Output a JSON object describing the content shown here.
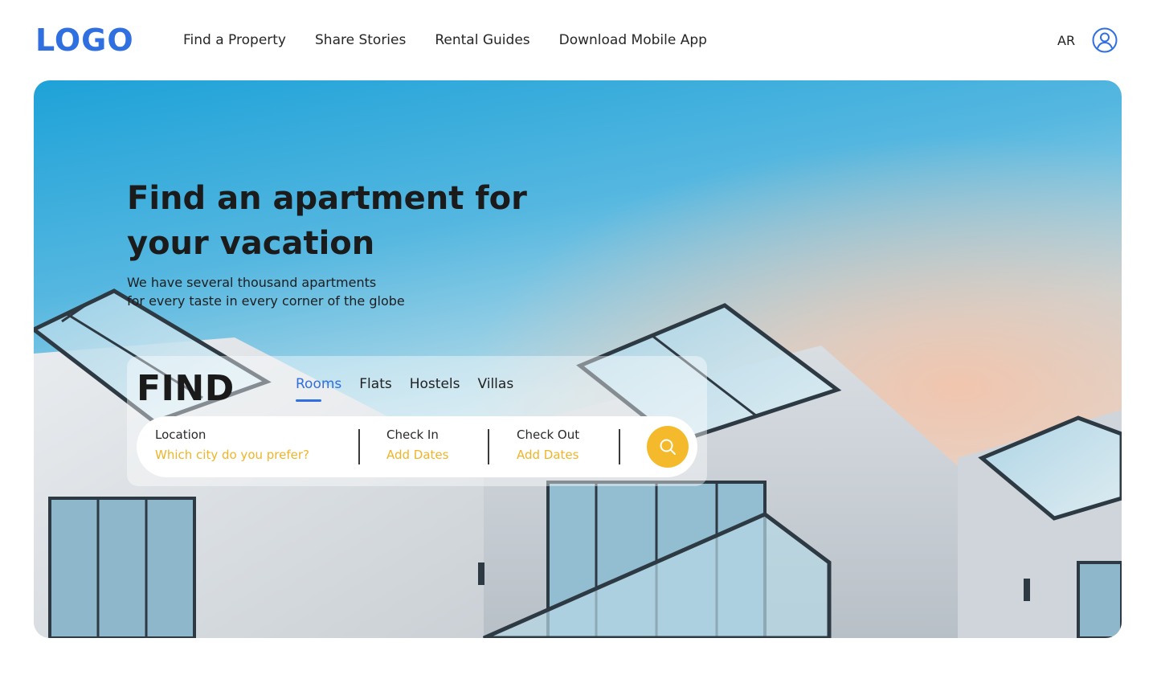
{
  "header": {
    "logo": "LOGO",
    "nav": [
      {
        "label": "Find a Property"
      },
      {
        "label": "Share Stories"
      },
      {
        "label": "Rental Guides"
      },
      {
        "label": "Download Mobile App"
      }
    ],
    "language": "AR",
    "user_icon": "user-circle-icon"
  },
  "hero": {
    "headline": "Find an apartment for your vacation",
    "subtext_line1": "We have several thousand apartments",
    "subtext_line2": "for every taste in every corner of the globe",
    "image": "modern-apartment-building-photo"
  },
  "search": {
    "title": "FIND",
    "tabs": [
      {
        "label": "Rooms",
        "active": true
      },
      {
        "label": "Flats",
        "active": false
      },
      {
        "label": "Hostels",
        "active": false
      },
      {
        "label": "Villas",
        "active": false
      }
    ],
    "location": {
      "label": "Location",
      "value": "Which city do you prefer?"
    },
    "check_in": {
      "label": "Check In",
      "value": "Add Dates"
    },
    "check_out": {
      "label": "Check Out",
      "value": "Add Dates"
    },
    "button_icon": "search-icon"
  },
  "colors": {
    "brand": "#2f6fe0",
    "accent": "#f5b92c",
    "placeholder": "#f0b428",
    "text": "#1f1f1f"
  }
}
